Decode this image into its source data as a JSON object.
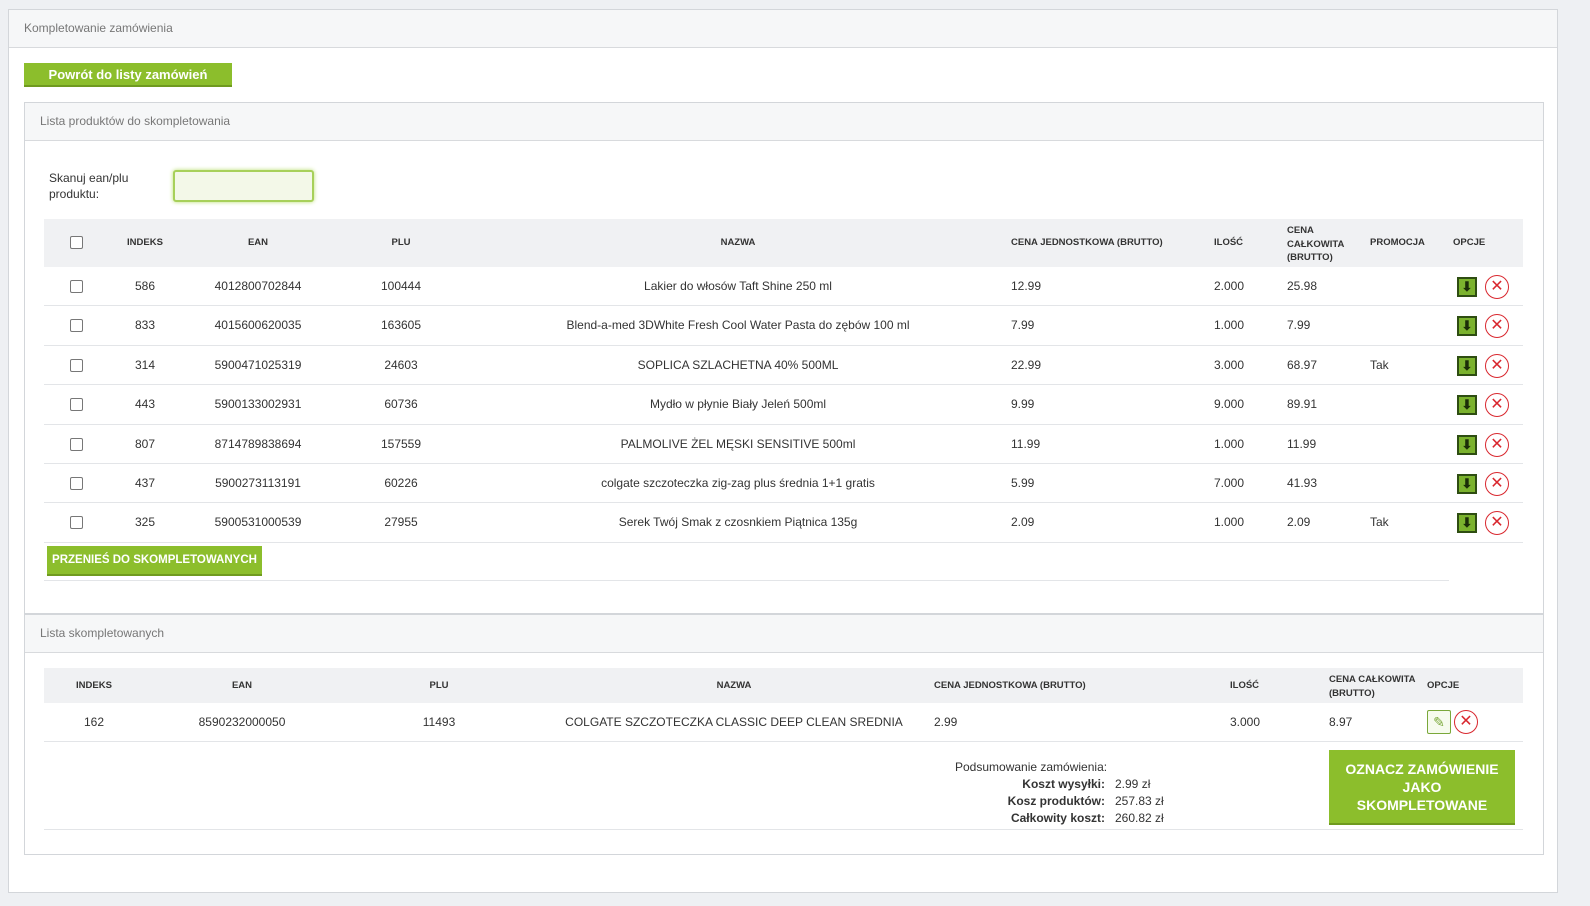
{
  "page": {
    "title": "Kompletowanie zamówienia"
  },
  "back_button": "Powrót do listy zamówień",
  "panel_todo": {
    "title": "Lista produktów do skompletowania",
    "scan_label": "Skanuj ean/plu produktu:",
    "scan_value": "",
    "headers": {
      "indeks": "INDEKS",
      "ean": "EAN",
      "plu": "PLU",
      "nazwa": "NAZWA",
      "cena_jedn": "CENA JEDNOSTKOWA (BRUTTO)",
      "ilosc": "ILOŚĆ",
      "cena_calk": "CENA CAŁKOWITA (BRUTTO)",
      "promocja": "PROMOCJA",
      "opcje": "OPCJE"
    },
    "rows": [
      {
        "indeks": "586",
        "ean": "4012800702844",
        "plu": "100444",
        "nazwa": "Lakier do włosów Taft Shine 250 ml",
        "cena_jedn": "12.99",
        "ilosc": "2.000",
        "cena_calk": "25.98",
        "promocja": ""
      },
      {
        "indeks": "833",
        "ean": "4015600620035",
        "plu": "163605",
        "nazwa": "Blend-a-med 3DWhite Fresh Cool Water Pasta do zębów 100 ml",
        "cena_jedn": "7.99",
        "ilosc": "1.000",
        "cena_calk": "7.99",
        "promocja": ""
      },
      {
        "indeks": "314",
        "ean": "5900471025319",
        "plu": "24603",
        "nazwa": "SOPLICA SZLACHETNA 40% 500ML",
        "cena_jedn": "22.99",
        "ilosc": "3.000",
        "cena_calk": "68.97",
        "promocja": "Tak"
      },
      {
        "indeks": "443",
        "ean": "5900133002931",
        "plu": "60736",
        "nazwa": "Mydło w płynie Biały Jeleń 500ml",
        "cena_jedn": "9.99",
        "ilosc": "9.000",
        "cena_calk": "89.91",
        "promocja": ""
      },
      {
        "indeks": "807",
        "ean": "8714789838694",
        "plu": "157559",
        "nazwa": "PALMOLIVE ŻEL MĘSKI SENSITIVE 500ml",
        "cena_jedn": "11.99",
        "ilosc": "1.000",
        "cena_calk": "11.99",
        "promocja": ""
      },
      {
        "indeks": "437",
        "ean": "5900273113191",
        "plu": "60226",
        "nazwa": "colgate szczoteczka zig-zag plus średnia 1+1 gratis",
        "cena_jedn": "5.99",
        "ilosc": "7.000",
        "cena_calk": "41.93",
        "promocja": ""
      },
      {
        "indeks": "325",
        "ean": "5900531000539",
        "plu": "27955",
        "nazwa": "Serek Twój Smak z czosnkiem Piątnica 135g",
        "cena_jedn": "2.09",
        "ilosc": "1.000",
        "cena_calk": "2.09",
        "promocja": "Tak"
      }
    ],
    "move_button": "PRZENIEŚ DO SKOMPLETOWANYCH"
  },
  "panel_done": {
    "title": "Lista skompletowanych",
    "headers": {
      "indeks": "INDEKS",
      "ean": "EAN",
      "plu": "PLU",
      "nazwa": "NAZWA",
      "cena_jedn": "CENA JEDNOSTKOWA (BRUTTO)",
      "ilosc": "ILOŚĆ",
      "cena_calk": "CENA CAŁKOWITA (BRUTTO)",
      "opcje": "OPCJE"
    },
    "rows": [
      {
        "indeks": "162",
        "ean": "8590232000050",
        "plu": "11493",
        "nazwa": "COLGATE SZCZOTECZKA CLASSIC DEEP CLEAN SREDNIA",
        "cena_jedn": "2.99",
        "ilosc": "3.000",
        "cena_calk": "8.97"
      }
    ],
    "summary": {
      "title": "Podsumowanie zamówienia:",
      "shipping_label": "Koszt wysyłki:",
      "shipping_value": "2.99 zł",
      "products_label": "Kosz produktów:",
      "products_value": "257.83 zł",
      "total_label": "Całkowity koszt:",
      "total_value": "260.82 zł"
    },
    "mark_button": "OZNACZ ZAMÓWIENIE JAKO SKOMPLETOWANE"
  },
  "icons": {
    "move_down": "download-arrow-icon",
    "delete": "close-circle-icon",
    "edit": "edit-note-icon"
  },
  "colors": {
    "accent": "#8cbe2c",
    "danger": "#d9272e"
  }
}
